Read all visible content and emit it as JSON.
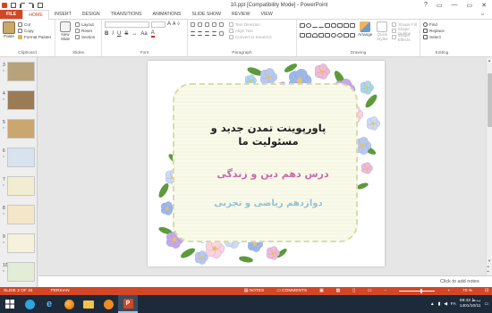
{
  "window": {
    "title": "10.ppt  [Compatibility Mode] - PowerPoint",
    "help": "?",
    "minimize": "—",
    "restore": "▭",
    "close": "✕"
  },
  "tabs": [
    "FILE",
    "HOME",
    "INSERT",
    "DESIGN",
    "TRANSITIONS",
    "ANIMATIONS",
    "SLIDE SHOW",
    "REVIEW",
    "VIEW"
  ],
  "user": "☺",
  "ribbon": {
    "clipboard": {
      "paste": "Paste",
      "cut": "Cut",
      "copy": "Copy",
      "format_painter": "Format Painter",
      "label": "Clipboard"
    },
    "slides": {
      "new_slide": "New Slide",
      "layout": "Layout",
      "reset": "Reset",
      "section": "Section",
      "label": "Slides"
    },
    "font": {
      "bold": "B",
      "italic": "I",
      "underline": "U",
      "strike": "S",
      "label": "Font"
    },
    "paragraph": {
      "text_direction": "Text Direction",
      "align_text": "Align Text",
      "convert_smartart": "Convert to SmartArt",
      "label": "Paragraph"
    },
    "drawing": {
      "arrange": "Arrange",
      "quick_styles": "Quick Styles",
      "shape_fill": "Shape Fill",
      "shape_outline": "Shape Outline",
      "shape_effects": "Shape Effects",
      "label": "Drawing"
    },
    "editing": {
      "find": "Find",
      "replace": "Replace",
      "select": "Select",
      "label": "Editing"
    }
  },
  "thumbnails": [
    {
      "num": "3",
      "color": "#b7a27a"
    },
    {
      "num": "4",
      "color": "#9b7a56"
    },
    {
      "num": "5",
      "color": "#caa670"
    },
    {
      "num": "6",
      "color": "#d9e3f0"
    },
    {
      "num": "7",
      "color": "#f2edd0"
    },
    {
      "num": "8",
      "color": "#f3e6c9"
    },
    {
      "num": "9",
      "color": "#f6f1dc"
    },
    {
      "num": "10",
      "color": "#e3ecd6"
    }
  ],
  "slide": {
    "title_line1": "پاورپوینت تمدن جدید و",
    "title_line2": "مسئولیت ما",
    "subtitle": "درس دهم دین و زندگی",
    "grade": "دوازدهم ریاضی و تجربی"
  },
  "notes_placeholder": "Click to add notes",
  "status": {
    "slide_info": "SLIDE 2 OF 34",
    "language": "PERSIAN",
    "notes": "NOTES",
    "comments": "COMMENTS",
    "zoom": "70 %"
  },
  "taskbar": {
    "clock_time": "08:43 ب.ظ",
    "clock_date": "1401/10/11",
    "lang": "FA"
  },
  "colors": {
    "accent": "#d24726",
    "taskbar": "#1c2a3a"
  }
}
